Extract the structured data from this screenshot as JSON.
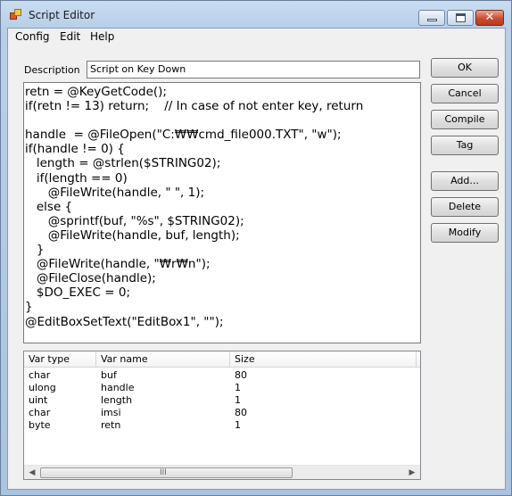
{
  "window": {
    "title": "Script Editor",
    "caption_buttons": {
      "minimize": "",
      "maximize": "",
      "close": "✕"
    }
  },
  "menu": [
    "Config",
    "Edit",
    "Help"
  ],
  "description": {
    "label": "Description",
    "value": "Script on Key Down"
  },
  "code": "retn = @KeyGetCode();\nif(retn != 13) return;    // In case of not enter key, return\n\nhandle  = @FileOpen(\"C:₩₩cmd_file000.TXT\", \"w\");\nif(handle != 0) {\n   length = @strlen($STRING02);\n   if(length == 0)\n      @FileWrite(handle, \" \", 1);\n   else {\n      @sprintf(buf, \"%s\", $STRING02);\n      @FileWrite(handle, buf, length);\n   }\n   @FileWrite(handle, \"₩r₩n\");\n   @FileClose(handle);\n   $DO_EXEC = 0;\n}\n@EditBoxSetText(\"EditBox1\", \"\");",
  "buttons": {
    "ok": "OK",
    "cancel": "Cancel",
    "compile": "Compile",
    "tag": "Tag",
    "add": "Add...",
    "delete": "Delete",
    "modify": "Modify"
  },
  "variables": {
    "columns": [
      "Var type",
      "Var name",
      "Size"
    ],
    "rows": [
      [
        "char",
        "buf",
        "80"
      ],
      [
        "ulong",
        "handle",
        "1"
      ],
      [
        "uint",
        "length",
        "1"
      ],
      [
        "char",
        "imsi",
        "80"
      ],
      [
        "byte",
        "retn",
        "1"
      ]
    ]
  },
  "scrollbar": {
    "left": "◀",
    "right": "▶",
    "grip": "III"
  },
  "colors": {
    "close_button": "#c94b32",
    "titlebar": "#b8cfe9"
  }
}
